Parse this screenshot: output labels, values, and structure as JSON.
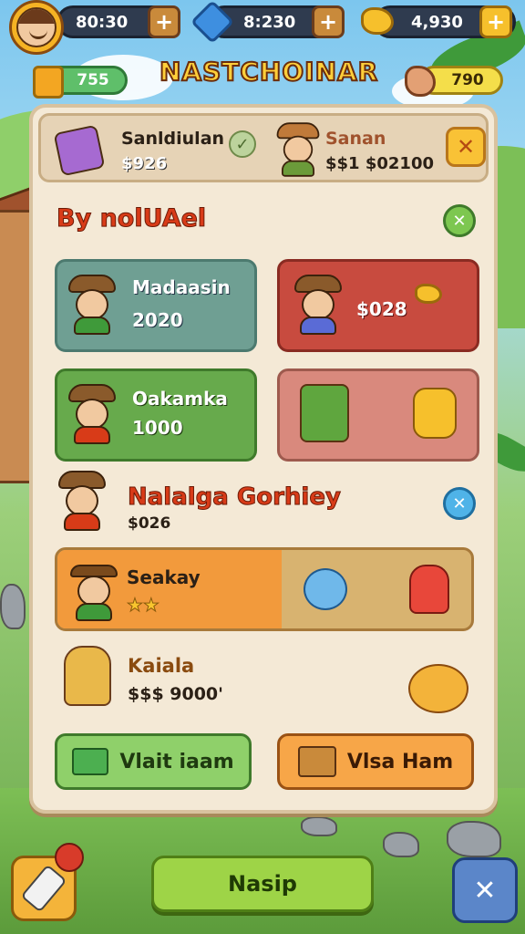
{
  "resources": {
    "coins": "80:30",
    "gems": "8:230",
    "gold": "4,930",
    "fuel": "755",
    "cargo": "790"
  },
  "title": "NASTCHOINAR",
  "header": {
    "left_name": "Sanldiulan",
    "left_price": "$926",
    "right_name": "Sanan",
    "right_price": "$$1 $02100"
  },
  "section1": {
    "title": "By nolUAel"
  },
  "cards": [
    {
      "name": "Madaasin",
      "value": "2020"
    },
    {
      "name": "",
      "value": "$028"
    },
    {
      "name": "Oakamka",
      "value": "1000"
    },
    {
      "name": "",
      "value": ""
    }
  ],
  "section2": {
    "title": "Nalalga Gorhiey",
    "price": "$026"
  },
  "featured": {
    "name": "Seakay",
    "stars": "★★"
  },
  "item_row": {
    "name": "Kaiala",
    "price": "$$$ 9000'"
  },
  "buttons": {
    "left": "Vlait iaam",
    "right": "Vlsa Ham",
    "main": "Nasip"
  },
  "colors": {
    "panel": "#f4e9d6",
    "accent_orange": "#f29a3c",
    "accent_green": "#9ed447",
    "title_red": "#d83b18"
  }
}
